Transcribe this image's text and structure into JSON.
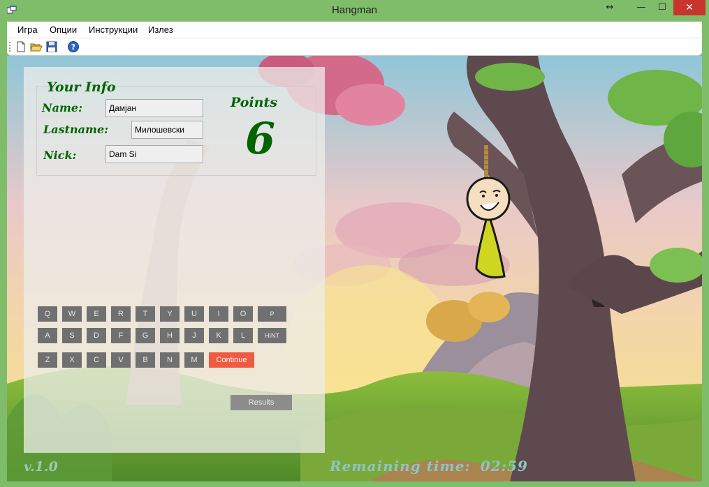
{
  "window": {
    "title": "Hangman",
    "resize_glyph": "↔",
    "minimize_glyph": "—",
    "maximize_glyph": "☐",
    "close_glyph": "✕"
  },
  "menu": {
    "items": [
      "Игра",
      "Опции",
      "Инструкции",
      "Излез"
    ]
  },
  "toolbar": {
    "icons": [
      "new-document-icon",
      "open-folder-icon",
      "save-icon",
      "help-icon"
    ]
  },
  "info": {
    "heading": "Your Info",
    "name_label": "Name:",
    "name_value": "Дамјан",
    "lastname_label": "Lastname:",
    "lastname_value": "Милошевски",
    "nick_label": "Nick:",
    "nick_value": "Dam Si"
  },
  "points": {
    "label": "Points",
    "value": "6"
  },
  "keyboard": {
    "row1": [
      "Q",
      "W",
      "E",
      "R",
      "T",
      "Y",
      "U",
      "I",
      "O",
      "P"
    ],
    "row2": [
      "A",
      "S",
      "D",
      "F",
      "G",
      "H",
      "J",
      "K",
      "L"
    ],
    "row3": [
      "Z",
      "X",
      "C",
      "V",
      "B",
      "N",
      "M"
    ],
    "hint_label": "HINT",
    "continue_label": "Continue",
    "results_label": "Results"
  },
  "footer": {
    "version": "v.1.0",
    "remaining_label": "Remaining time:",
    "remaining_value": "02:59"
  },
  "colors": {
    "accent_green": "#006400",
    "continue_red": "#f05a40",
    "close_red": "#c7352c",
    "key_gray": "#707070"
  }
}
